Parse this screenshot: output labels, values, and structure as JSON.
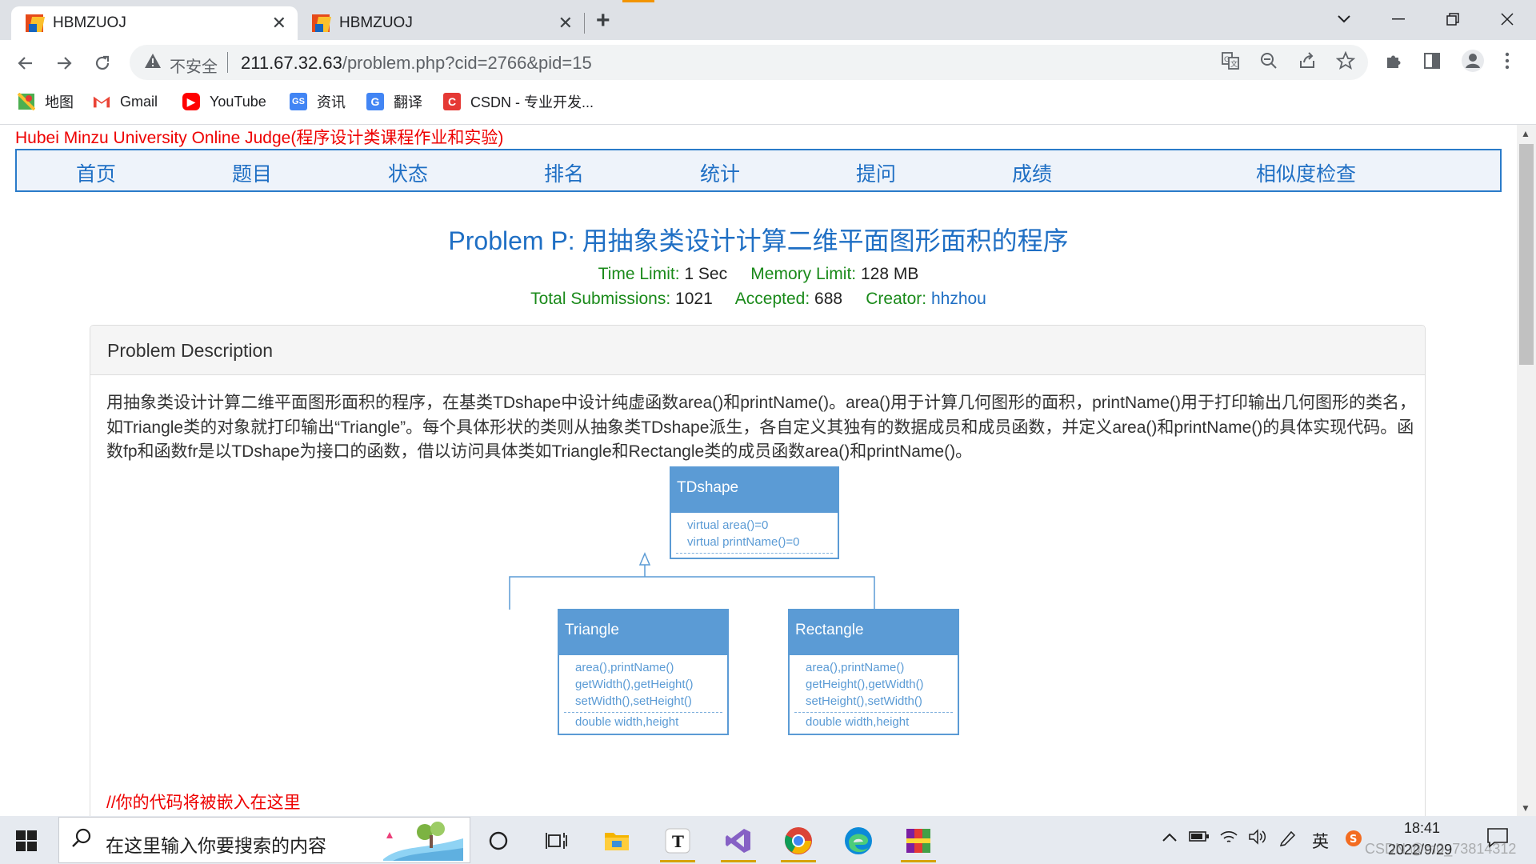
{
  "browser": {
    "tabs": [
      {
        "title": "HBMZUOJ",
        "active": true
      },
      {
        "title": "HBMZUOJ",
        "active": false
      }
    ],
    "address": {
      "security_label": "不安全",
      "host": "211.67.32.63",
      "path": "/problem.php?cid=2766&pid=15"
    },
    "bookmarks": [
      "地图",
      "Gmail",
      "YouTube",
      "资讯",
      "翻译",
      "CSDN - 专业开发..."
    ]
  },
  "site": {
    "title": "Hubei Minzu University Online Judge(程序设计类课程作业和实验)",
    "nav": [
      "首页",
      "题目",
      "状态",
      "排名",
      "统计",
      "提问",
      "成绩",
      "相似度检查"
    ]
  },
  "problem": {
    "title": "Problem P: 用抽象类设计计算二维平面图形面积的程序",
    "time_limit_label": "Time Limit:",
    "time_limit": "1 Sec",
    "memory_limit_label": "Memory Limit:",
    "memory_limit": "128 MB",
    "submissions_label": "Total Submissions:",
    "submissions": "1021",
    "accepted_label": "Accepted:",
    "accepted": "688",
    "creator_label": "Creator:",
    "creator": "hhzhou",
    "section_header": "Problem Description",
    "description": "用抽象类设计计算二维平面图形面积的程序，在基类TDshape中设计纯虚函数area()和printName()。area()用于计算几何图形的面积，printName()用于打印输出几何图形的类名，如Triangle类的对象就打印输出“Triangle”。每个具体形状的类则从抽象类TDshape派生，各自定义其独有的数据成员和成员函数，并定义area()和printName()的具体实现代码。函数fp和函数fr是以TDshape为接口的函数，借以访问具体类如Triangle和Rectangle类的成员函数area()和printName()。",
    "code_hint": "//你的代码将被嵌入在这里"
  },
  "uml": {
    "base": {
      "name": "TDshape",
      "methods": [
        "virtual area()=0",
        "virtual printName()=0"
      ]
    },
    "triangle": {
      "name": "Triangle",
      "methods": [
        "area(),printName()",
        "getWidth(),getHeight()",
        "setWidth(),setHeight()"
      ],
      "fields": [
        "double width,height"
      ]
    },
    "rectangle": {
      "name": "Rectangle",
      "methods": [
        "area(),printName()",
        "getHeight(),getWidth()",
        "setHeight(),setWidth()"
      ],
      "fields": [
        "double width,height"
      ]
    }
  },
  "taskbar": {
    "search_placeholder": "在这里输入你要搜索的内容",
    "ime": "英",
    "time": "18:41",
    "date": "2022/9/29",
    "watermark": "CSDN @m0_73814312"
  },
  "colors": {
    "site_title": "#ee0000",
    "link_blue": "#1f6fc4",
    "meta_green": "#1a8a1a",
    "uml_blue": "#5b9bd5"
  }
}
